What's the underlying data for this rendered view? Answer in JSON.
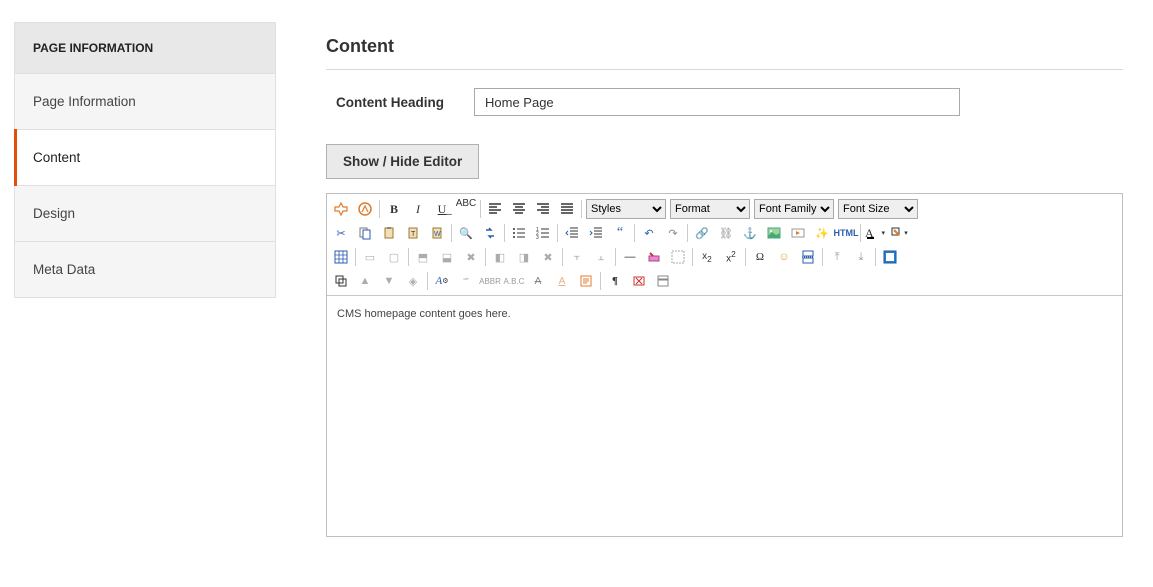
{
  "sidebar": {
    "header": "PAGE INFORMATION",
    "items": [
      {
        "label": "Page Information",
        "active": false
      },
      {
        "label": "Content",
        "active": true
      },
      {
        "label": "Design",
        "active": false
      },
      {
        "label": "Meta Data",
        "active": false
      }
    ]
  },
  "main": {
    "section_title": "Content",
    "heading_label": "Content Heading",
    "heading_value": "Home Page",
    "toggle_label": "Show / Hide Editor",
    "selects": {
      "styles": "Styles",
      "format": "Format",
      "font_family": "Font Family",
      "font_size": "Font Size"
    },
    "body_text": "CMS homepage content goes here."
  }
}
